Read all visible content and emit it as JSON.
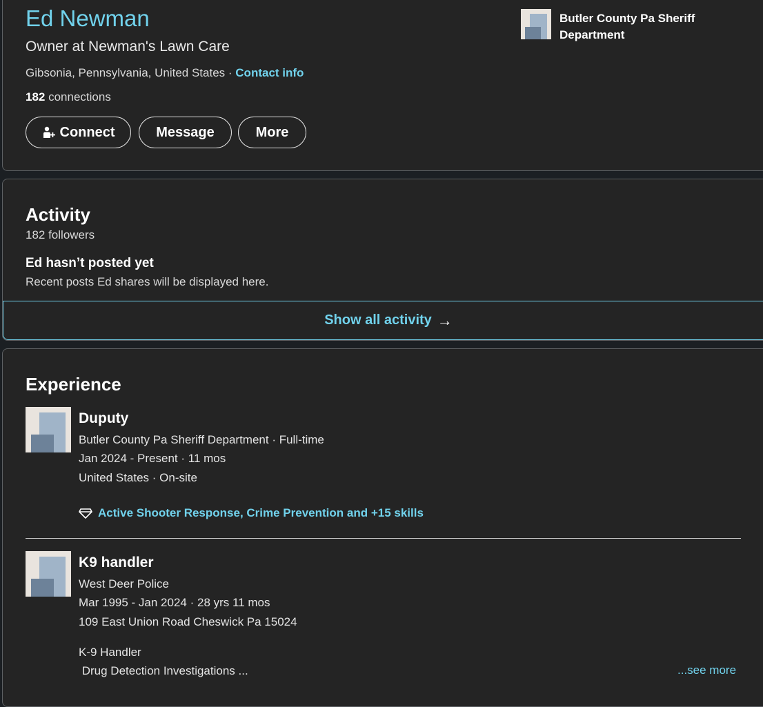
{
  "intro": {
    "name": "Ed Newman",
    "headline": "Owner at Newman's Lawn Care",
    "location": "Gibsonia, Pennsylvania, United States",
    "location_sep": " · ",
    "contact_info": "Contact info",
    "connections_count": "182",
    "connections_label": " connections",
    "buttons": {
      "connect": "Connect",
      "message": "Message",
      "more": "More"
    },
    "current_company": "Butler County Pa Sheriff Department"
  },
  "activity": {
    "title": "Activity",
    "followers": "182 followers",
    "empty_title": "Ed hasn’t posted yet",
    "empty_desc": "Recent posts Ed shares will be displayed here.",
    "show_all": "Show all activity"
  },
  "experience": {
    "title": "Experience",
    "items": [
      {
        "title": "Duputy",
        "company": "Butler County Pa Sheriff Department · Full-time",
        "dates": "Jan 2024 - Present · 11 mos",
        "location": "United States · On-site",
        "skills": "Active Shooter Response, Crime Prevention and +15 skills"
      },
      {
        "title": "K9 handler",
        "company": "West Deer Police",
        "dates": "Mar 1995 - Jan 2024 · 28 yrs 11 mos",
        "location": "109 East Union Road Cheswick Pa 15024",
        "description_line1": "K-9 Handler",
        "description_line2": " Drug Detection Investigations ...",
        "see_more": "...see more"
      }
    ]
  },
  "colors": {
    "accent": "#71d2ec",
    "card_bg": "#242424",
    "page_bg": "#1b1f23",
    "border": "#5d6063"
  },
  "icons": {
    "connect": "add-person-icon",
    "arrow": "arrow-right-icon",
    "skills": "diamond-icon",
    "company_logo": "company-logo-icon"
  }
}
